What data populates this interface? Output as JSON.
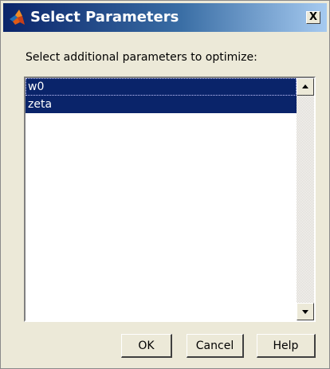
{
  "window": {
    "title": "Select Parameters",
    "close_label": "X"
  },
  "dialog": {
    "prompt": "Select additional parameters to optimize:"
  },
  "parameter_list": {
    "items": [
      {
        "label": "w0",
        "selected": true
      },
      {
        "label": "zeta",
        "selected": true
      }
    ]
  },
  "buttons": {
    "ok": "OK",
    "cancel": "Cancel",
    "help": "Help"
  },
  "icons": {
    "app": "matlab-icon",
    "close": "close-icon",
    "scroll_up": "scroll-up-arrow-icon",
    "scroll_down": "scroll-down-arrow-icon"
  },
  "colors": {
    "title_gradient_start": "#0a246a",
    "title_gradient_end": "#a6caf0",
    "selection": "#0a246a",
    "dialog_background": "#ece9d8"
  }
}
